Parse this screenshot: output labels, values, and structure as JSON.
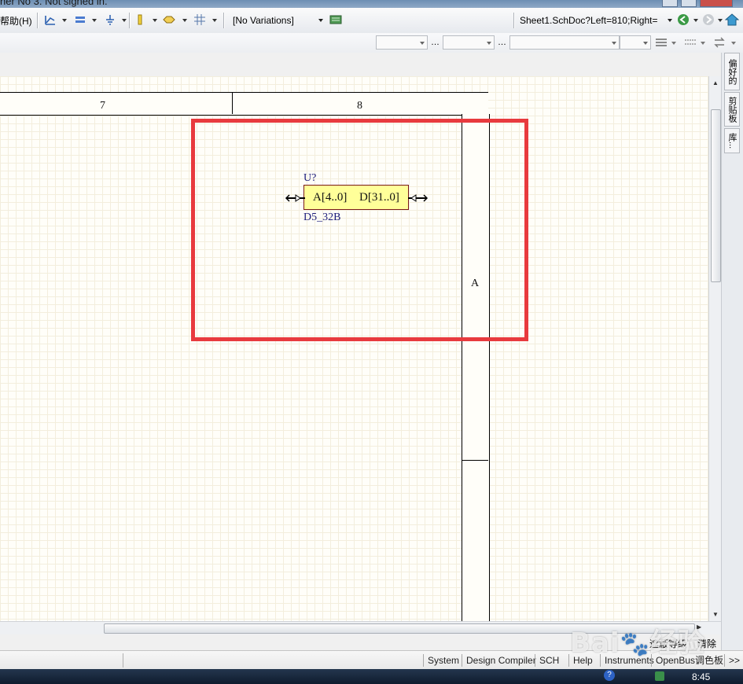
{
  "titlebar": {
    "text": "her No 3. Not signed in."
  },
  "toolbar": {
    "help_menu": "帮助(H)",
    "variations_value": "[No Variations]",
    "address_value": "Sheet1.SchDoc?Left=810;Right="
  },
  "sidepanel": {
    "tabs": [
      "偏好的",
      "剪贴板",
      "库..."
    ]
  },
  "schematic": {
    "columns": [
      "7",
      "8"
    ],
    "row_label": "A",
    "component": {
      "designator": "U?",
      "comment": "D5_32B",
      "left_pin": "A[4..0]",
      "right_pin": "D[31..0]"
    }
  },
  "bottombar": {
    "clear_label": "清除",
    "mask_label": "遮蔽等级"
  },
  "statusbar": {
    "buttons": [
      "System",
      "Design Compiler",
      "SCH",
      "Help",
      "Instruments",
      "OpenBus调色板",
      ">>"
    ]
  },
  "taskbar": {
    "time": "8:45"
  },
  "watermark": {
    "text": "Bai 经验"
  },
  "colors": {
    "highlight": "#e83a3e",
    "component_fill": "#ffff99",
    "designator": "#1c1c7a"
  },
  "icons": [
    "wire-icon",
    "bus-icon",
    "ground-icon",
    "port-icon",
    "net-label-icon",
    "grid-icon",
    "variation-icon",
    "back-icon",
    "forward-icon",
    "home-icon"
  ]
}
